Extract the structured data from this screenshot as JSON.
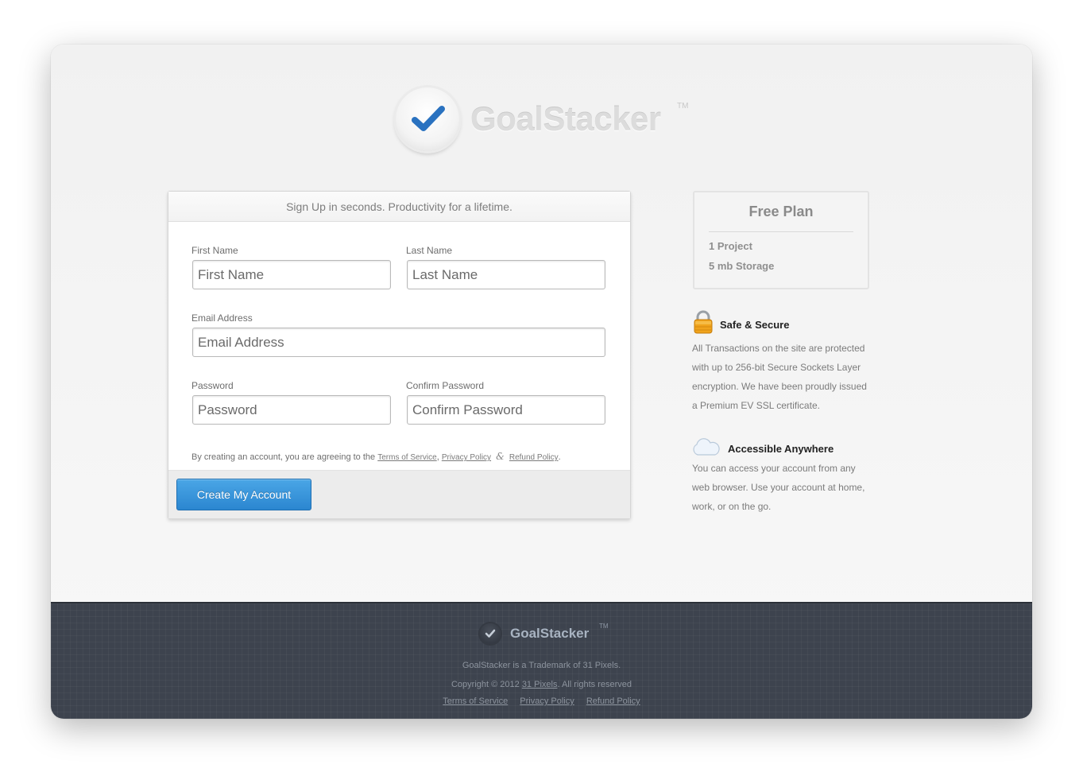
{
  "brand": {
    "name": "GoalStacker",
    "trademark": "TM"
  },
  "signup": {
    "heading": "Sign Up in seconds. Productivity for a lifetime.",
    "first_name": {
      "label": "First Name",
      "placeholder": "First Name"
    },
    "last_name": {
      "label": "Last Name",
      "placeholder": "Last Name"
    },
    "email": {
      "label": "Email Address",
      "placeholder": "Email Address"
    },
    "password": {
      "label": "Password",
      "placeholder": "Password"
    },
    "confirm_password": {
      "label": "Confirm Password",
      "placeholder": "Confirm Password"
    },
    "agreement_prefix": "By creating an account, you are agreeing to the",
    "terms_link": "Terms of Service",
    "comma": ",",
    "privacy_link": "Privacy Policy",
    "ampersand": "&",
    "refund_link": "Refund Policy",
    "period": ".",
    "submit_label": "Create My Account"
  },
  "plan": {
    "title": "Free Plan",
    "items": [
      "1 Project",
      "5 mb Storage"
    ]
  },
  "features": [
    {
      "icon": "lock-icon",
      "title": "Safe & Secure",
      "text": "All Transactions on the site are protected with up to 256-bit Secure Sockets Layer encryption. We have been proudly issued a Premium EV SSL certificate."
    },
    {
      "icon": "cloud-icon",
      "title": "Accessible Anywhere",
      "text": "You can access your account from any web browser. Use your account at home, work, or on the go."
    }
  ],
  "footer": {
    "brand": "GoalStacker",
    "trademark": "TM",
    "trademark_line": "GoalStacker is a Trademark of 31 Pixels.",
    "copyright_prefix": "Copyright © 2012",
    "company_link": "31 Pixels",
    "copyright_suffix": ". All rights reserved",
    "links": [
      "Terms of Service",
      "Privacy Policy",
      "Refund Policy"
    ]
  },
  "colors": {
    "accent_button": "#2b86d0",
    "check_blue": "#2a72c0",
    "footer_bg": "#3d434e"
  }
}
